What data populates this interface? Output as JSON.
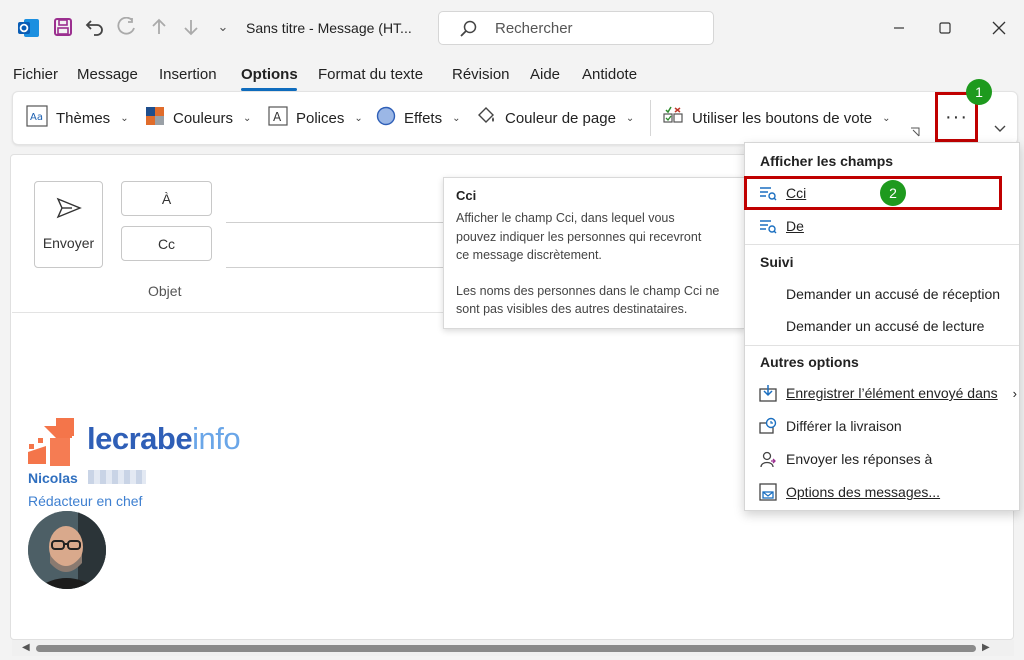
{
  "titlebar": {
    "title": "Sans titre  -  Message (HT...",
    "search_placeholder": "Rechercher",
    "quick_access_more": "⌄"
  },
  "menu_tabs": [
    "Fichier",
    "Message",
    "Insertion",
    "Options",
    "Format du texte",
    "Révision",
    "Aide",
    "Antidote"
  ],
  "ribbon": {
    "themes": "Thèmes",
    "colors": "Couleurs",
    "fonts": "Polices",
    "effects": "Effets",
    "page_color": "Couleur de page",
    "voting": "Utiliser les boutons de vote",
    "more": "···",
    "badge": "1"
  },
  "compose": {
    "send": "Envoyer",
    "to": "À",
    "cc": "Cc",
    "subject": "Objet"
  },
  "tooltip": {
    "title": "Cci",
    "lines": [
      "Afficher le champ Cci, dans lequel vous",
      "pouvez indiquer les personnes qui recevront",
      "ce message discrètement.",
      "Les noms des personnes dans le champ Cci ne",
      "sont pas visibles des autres destinataires."
    ]
  },
  "dropdown": {
    "show_fields_header": "Afficher les champs",
    "cci": "Cci",
    "de": "De",
    "badge": "2",
    "tracking_header": "Suivi",
    "read_receipt_delivery": "Demander un accusé de réception",
    "read_receipt_read": "Demander un accusé de lecture",
    "more_options_header": "Autres options",
    "save_sent": "Enregistrer l’élément envoyé dans",
    "delay_delivery": "Différer la livraison",
    "direct_replies": "Envoyer les réponses à",
    "message_options": "Options des messages..."
  },
  "signature": {
    "brand_main": "lecrabe",
    "brand_accent": "info",
    "name": "Nicolas",
    "role": "Rédacteur en chef"
  },
  "colors": {
    "accent": "#0f6cbd",
    "highlight_red": "#c00000",
    "badge_green": "#1e9a1e",
    "brand_orange": "#f4754a",
    "brand_blue": "#2f5fb7"
  }
}
